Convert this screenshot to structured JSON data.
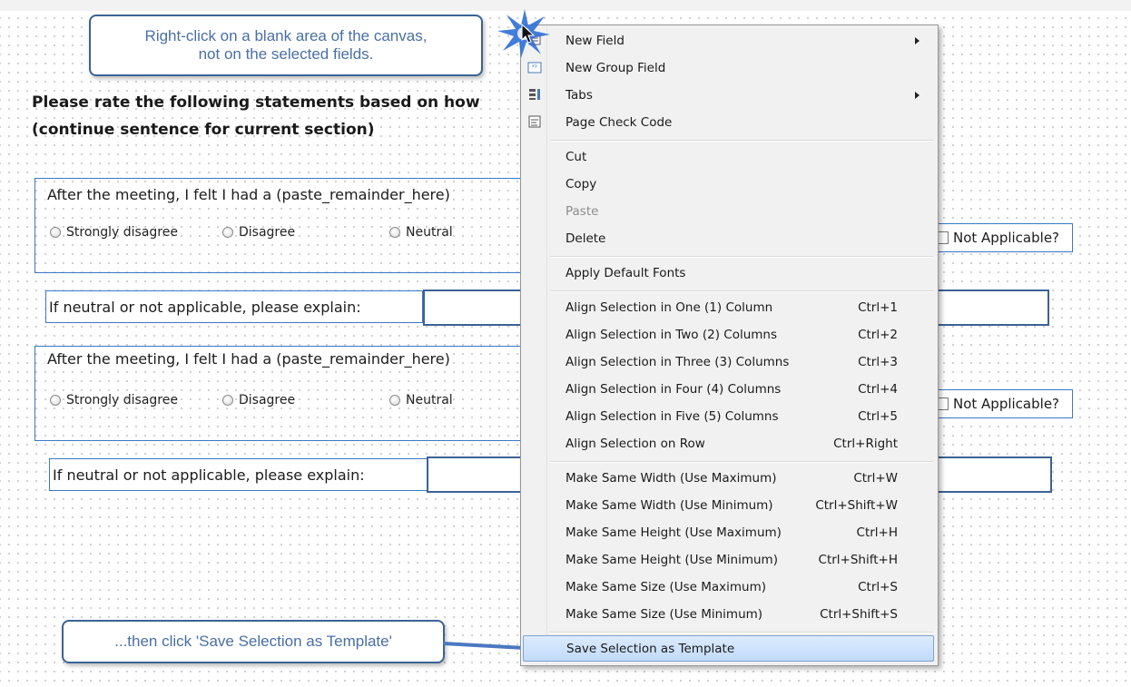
{
  "callouts": {
    "top_line1": "Right-click on a blank area of the canvas,",
    "top_line2": "not on the selected fields.",
    "bottom": "...then click 'Save Selection as Template'"
  },
  "heading": {
    "line1": "Please rate the following statements based on how",
    "line2": "(continue sentence for current section)"
  },
  "questions": [
    {
      "label": "After the meeting, I felt I had a (paste_remainder_here)",
      "options": [
        "Strongly disagree",
        "Disagree",
        "Neutral"
      ],
      "na_label": "Not Applicable?",
      "explain_label": "If neutral or not applicable, please explain:"
    },
    {
      "label": "After the meeting, I felt I had a (paste_remainder_here)",
      "options": [
        "Strongly disagree",
        "Disagree",
        "Neutral"
      ],
      "na_label": "Not Applicable?",
      "explain_label": "If neutral or not applicable, please explain:"
    }
  ],
  "menu": {
    "items": [
      {
        "label": "New Field",
        "icon": "new-field-icon",
        "submenu": true
      },
      {
        "label": "New Group Field",
        "icon": "group-field-icon"
      },
      {
        "label": "Tabs",
        "icon": "tabs-icon",
        "submenu": true
      },
      {
        "label": "Page Check Code",
        "icon": "check-code-icon"
      },
      {
        "label": "Cut"
      },
      {
        "label": "Copy"
      },
      {
        "label": "Paste",
        "disabled": true
      },
      {
        "label": "Delete"
      },
      {
        "label": "Apply Default Fonts"
      },
      {
        "label": "Align Selection in One (1) Column",
        "shortcut": "Ctrl+1"
      },
      {
        "label": "Align Selection in Two (2) Columns",
        "shortcut": "Ctrl+2"
      },
      {
        "label": "Align Selection in Three (3) Columns",
        "shortcut": "Ctrl+3"
      },
      {
        "label": "Align Selection in Four (4) Columns",
        "shortcut": "Ctrl+4"
      },
      {
        "label": "Align Selection in Five (5) Columns",
        "shortcut": "Ctrl+5"
      },
      {
        "label": "Align Selection on Row",
        "shortcut": "Ctrl+Right"
      },
      {
        "label": "Make Same Width (Use Maximum)",
        "shortcut": "Ctrl+W"
      },
      {
        "label": "Make Same Width (Use Minimum)",
        "shortcut": "Ctrl+Shift+W"
      },
      {
        "label": "Make Same Height (Use Maximum)",
        "shortcut": "Ctrl+H"
      },
      {
        "label": "Make Same Height (Use Minimum)",
        "shortcut": "Ctrl+Shift+H"
      },
      {
        "label": "Make Same Size (Use Maximum)",
        "shortcut": "Ctrl+S"
      },
      {
        "label": "Make Same Size (Use Minimum)",
        "shortcut": "Ctrl+Shift+S"
      },
      {
        "label": "Save Selection as Template",
        "highlighted": true
      }
    ]
  },
  "colors": {
    "accent": "#3a78c4",
    "callout_border": "#3d6294",
    "menu_highlight": "#c1dbfc"
  }
}
